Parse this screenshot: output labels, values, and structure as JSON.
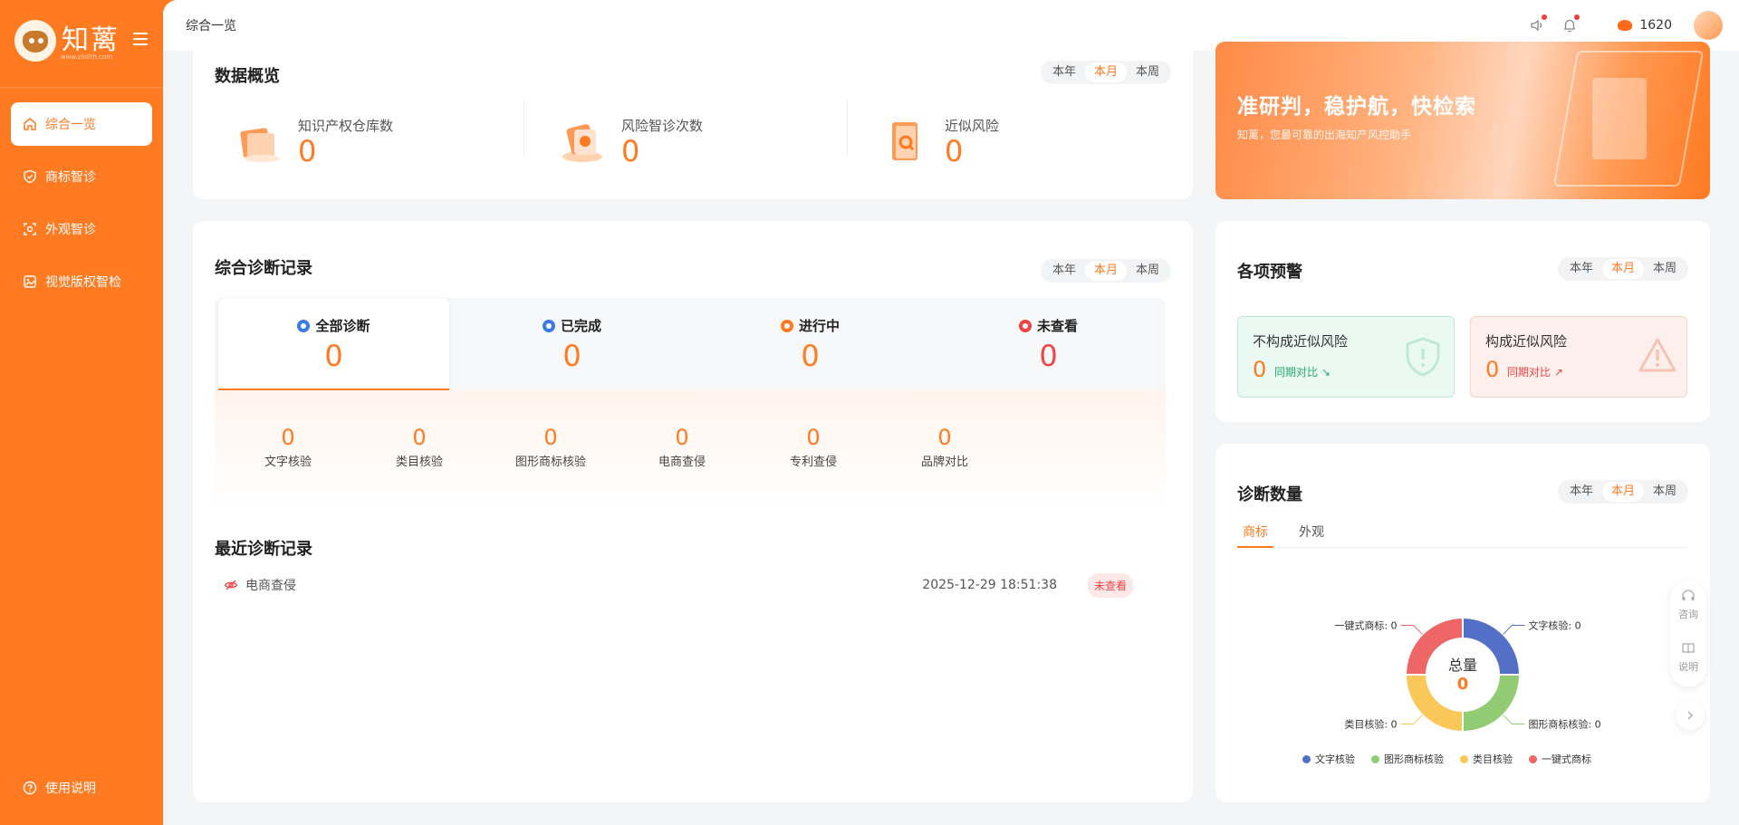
{
  "brand": {
    "name": "知蓠",
    "url": "www.zhilith.com"
  },
  "sidebar": {
    "items": [
      {
        "label": "综合一览",
        "icon": "home-icon"
      },
      {
        "label": "商标智诊",
        "icon": "shield-check-icon"
      },
      {
        "label": "外观智诊",
        "icon": "scan-face-icon"
      },
      {
        "label": "视觉版权智检",
        "icon": "image-icon"
      }
    ],
    "help_label": "使用说明"
  },
  "topbar": {
    "page_tag": "综合一览",
    "points": "1620"
  },
  "periods": [
    "本年",
    "本月",
    "本周"
  ],
  "overview": {
    "title": "数据概览",
    "stats": [
      {
        "label": "知识产权仓库数",
        "value": "0"
      },
      {
        "label": "风险智诊次数",
        "value": "0"
      },
      {
        "label": "近似风险",
        "value": "0"
      }
    ]
  },
  "banner": {
    "title": "准研判，稳护航，快检索",
    "subtitle": "知蓠，您最可靠的出海知产风控助手"
  },
  "records": {
    "title": "综合诊断记录",
    "tabs": [
      {
        "label": "全部诊断",
        "value": "0",
        "color": "#3a7be8"
      },
      {
        "label": "已完成",
        "value": "0",
        "color": "#3a7be8"
      },
      {
        "label": "进行中",
        "value": "0",
        "color": "#ff7a21"
      },
      {
        "label": "未查看",
        "value": "0",
        "color": "#f04545"
      }
    ],
    "subs": [
      {
        "label": "文字核验",
        "value": "0"
      },
      {
        "label": "类目核验",
        "value": "0"
      },
      {
        "label": "图形商标核验",
        "value": "0"
      },
      {
        "label": "电商查侵",
        "value": "0"
      },
      {
        "label": "专利查侵",
        "value": "0"
      },
      {
        "label": "品牌对比",
        "value": "0"
      }
    ]
  },
  "recent": {
    "title": "最近诊断记录",
    "items": [
      {
        "name": "电商查侵",
        "time": "2025-12-29 18:51:38",
        "status": "未查看"
      }
    ]
  },
  "warnings": {
    "title": "各项预警",
    "cards": [
      {
        "title": "不构成近似风险",
        "value": "0",
        "compare": "同期对比"
      },
      {
        "title": "构成近似风险",
        "value": "0",
        "compare": "同期对比"
      }
    ]
  },
  "diagnosis": {
    "title": "诊断数量",
    "tabs": [
      "商标",
      "外观"
    ],
    "center_label": "总量",
    "center_value": "0"
  },
  "chart_data": {
    "type": "pie",
    "categories": [
      "文字核验",
      "图形商标核验",
      "类目核验",
      "一键式商标"
    ],
    "values": [
      0,
      0,
      0,
      0
    ],
    "slice_labels": [
      "文字核验: 0",
      "图形商标核验: 0",
      "类目核验: 0",
      "一键式商标: 0"
    ],
    "colors": [
      "#5470c6",
      "#91cc75",
      "#fac858",
      "#ee6666"
    ],
    "legend": "bottom"
  },
  "float_tools": {
    "consult": "咨询",
    "guide": "说明"
  }
}
